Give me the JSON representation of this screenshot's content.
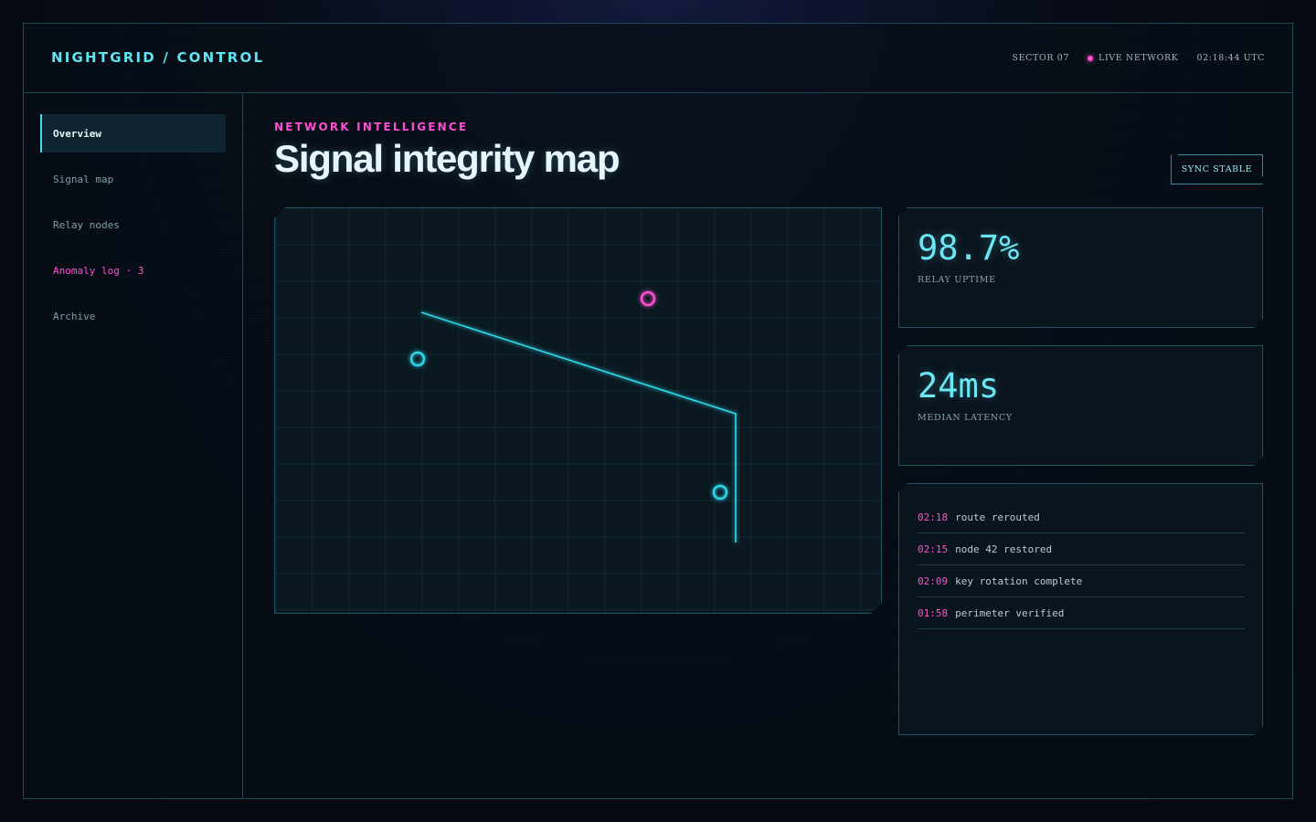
{
  "header": {
    "brand": "NIGHTGRID / CONTROL",
    "sector": "SECTOR 07",
    "live_label": "LIVE NETWORK",
    "clock": "02:18:44 UTC"
  },
  "sidebar": {
    "items": [
      {
        "label": "Overview",
        "state": "active"
      },
      {
        "label": "Signal map",
        "state": "default"
      },
      {
        "label": "Relay nodes",
        "state": "default"
      },
      {
        "label": "Anomaly log · 3",
        "state": "alert"
      },
      {
        "label": "Archive",
        "state": "default"
      }
    ]
  },
  "main": {
    "eyebrow": "NETWORK INTELLIGENCE",
    "title": "Signal integrity map",
    "sync_badge": "SYNC STABLE"
  },
  "map": {
    "node_colors": {
      "relay": "#2fd6ea",
      "anomaly": "#ff4fd1"
    },
    "nodes": [
      {
        "kind": "relay"
      },
      {
        "kind": "anomaly"
      },
      {
        "kind": "relay"
      }
    ]
  },
  "metrics": [
    {
      "value": "98.7%",
      "label": "RELAY UPTIME"
    },
    {
      "value": "24ms",
      "label": "MEDIAN LATENCY"
    }
  ],
  "log": [
    {
      "time": "02:18",
      "text": "route rerouted"
    },
    {
      "time": "02:15",
      "text": "node 42 restored"
    },
    {
      "time": "02:09",
      "text": "key rotation complete"
    },
    {
      "time": "01:58",
      "text": "perimeter verified"
    }
  ],
  "colors": {
    "accent_cyan": "#5fe3f0",
    "accent_magenta": "#ff4fd1",
    "border": "#1d4a55",
    "background": "#070c16"
  }
}
